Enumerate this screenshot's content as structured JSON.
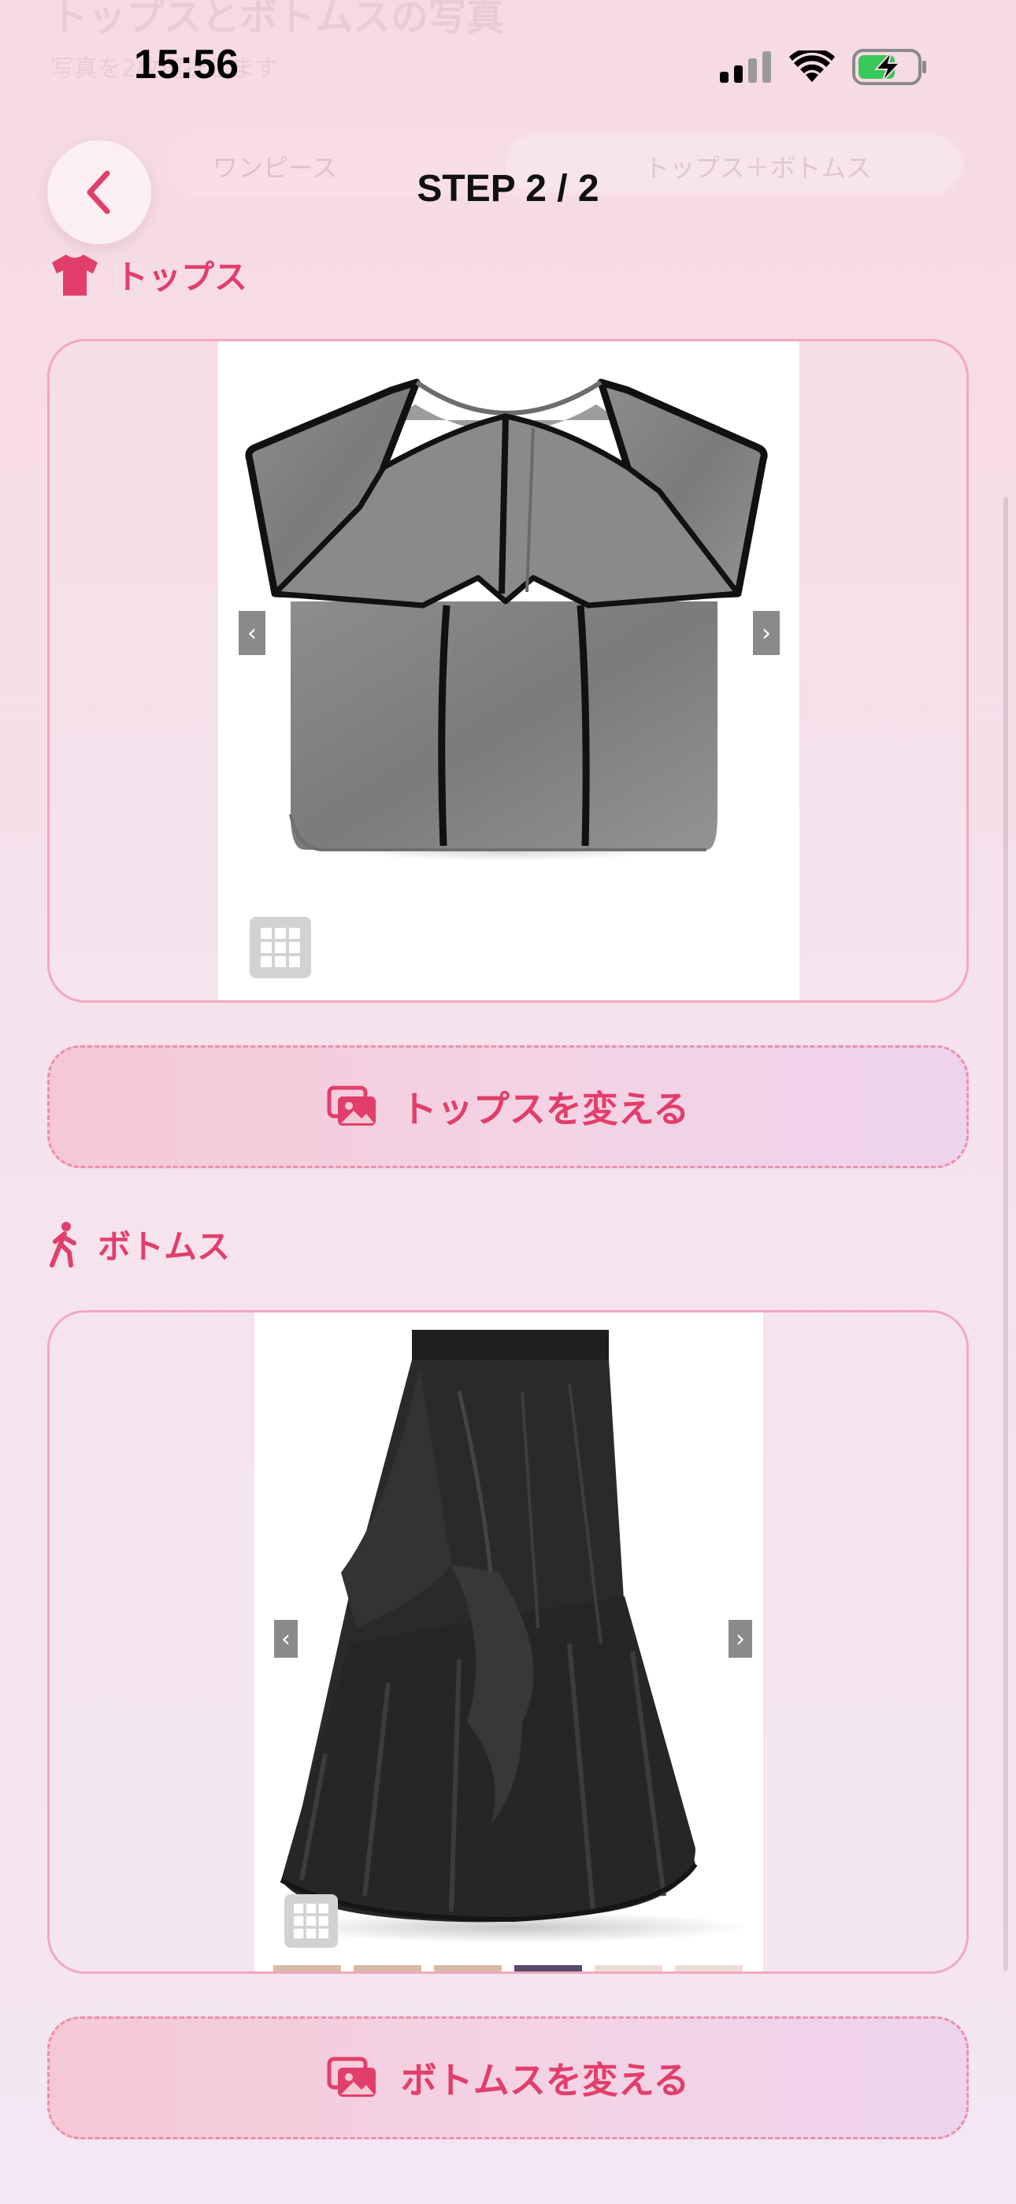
{
  "background_header": {
    "title": "トップスとボトムスの写真",
    "subtitle": "写真を2枚選択します",
    "segment_left": "ワンピース",
    "segment_right": "トップス＋ボトムス"
  },
  "status_bar": {
    "time": "15:56"
  },
  "header": {
    "step_title": "STEP 2 / 2",
    "back_icon": "chevron-left-icon"
  },
  "tops": {
    "label": "トップス",
    "icon": "tshirt-icon",
    "prev_arrow": "‹",
    "next_arrow": "›",
    "change_label": "トップスを変える"
  },
  "bottoms": {
    "label": "ボトムス",
    "icon": "walking-person-icon",
    "prev_arrow": "‹",
    "next_arrow": "›",
    "change_label": "ボトムスを変える"
  },
  "colors": {
    "accent": "#e23e6b",
    "card_border": "#f0a8bf",
    "button_border": "#eb8fab"
  }
}
